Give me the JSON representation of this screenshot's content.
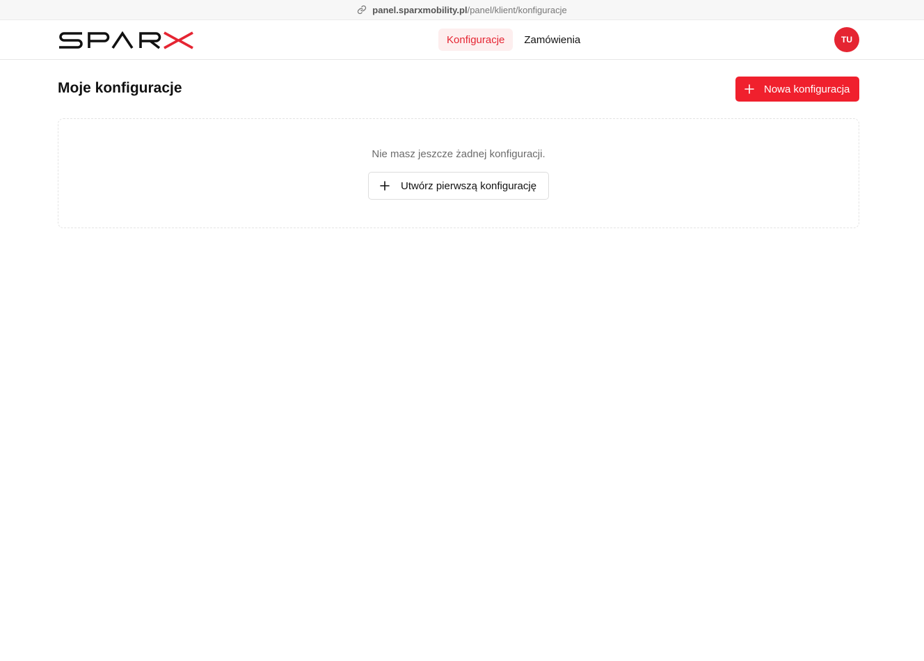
{
  "browser": {
    "url_domain": "panel.sparxmobility.pl",
    "url_path": "/panel/klient/konfiguracje",
    "link_icon": "link-icon"
  },
  "header": {
    "logo_text": "SPARX",
    "nav": [
      {
        "label": "Konfiguracje",
        "active": true
      },
      {
        "label": "Zamówienia",
        "active": false
      }
    ],
    "avatar_initials": "TU"
  },
  "main": {
    "title": "Moje konfiguracje",
    "new_button_label": "Nowa konfiguracja",
    "new_button_icon": "plus-icon",
    "empty_state": {
      "message": "Nie masz jeszcze żadnej konfiguracji.",
      "button_label": "Utwórz pierwszą konfigurację",
      "button_icon": "plus-icon"
    }
  },
  "colors": {
    "accent": "#e52532",
    "primary_button": "#f0202d",
    "active_tab_bg": "#fdeeee"
  }
}
